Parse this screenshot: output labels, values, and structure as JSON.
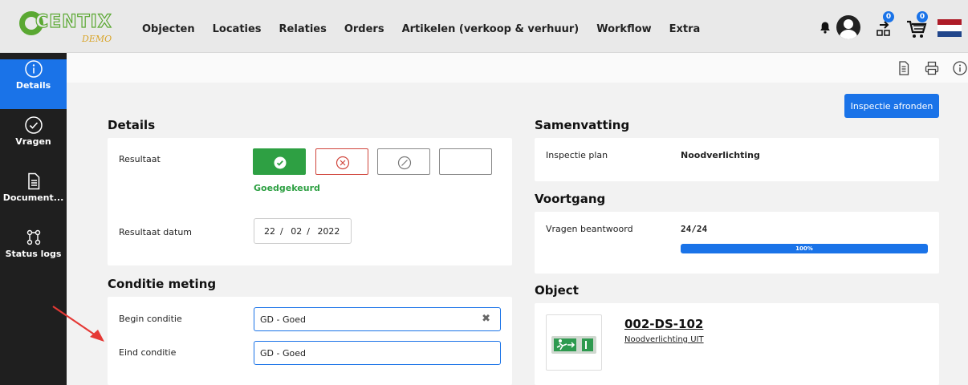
{
  "brand": {
    "logo_text": "CENTIX",
    "logo_sub": "DEMO",
    "green": "#5aa832",
    "gold": "#d9a52a"
  },
  "nav": {
    "items": [
      "Objecten",
      "Locaties",
      "Relaties",
      "Orders",
      "Artikelen (verkoop & verhuur)",
      "Workflow",
      "Extra"
    ]
  },
  "top_icons": {
    "bell": "bell-icon",
    "user": "user-avatar-icon",
    "transfer": "transfer-icon",
    "transfer_badge": "0",
    "cart": "cart-icon",
    "cart_badge": "0",
    "flag": "dutch-flag-icon"
  },
  "sidebar": {
    "items": [
      {
        "label": "Details",
        "icon": "info-icon",
        "active": true
      },
      {
        "label": "Vragen",
        "icon": "check-circle-icon",
        "active": false
      },
      {
        "label": "Document...",
        "icon": "document-icon",
        "active": false
      },
      {
        "label": "Status logs",
        "icon": "status-logs-icon",
        "active": false
      }
    ]
  },
  "toolbar": {
    "icons": [
      "file-icon",
      "print-icon",
      "info-icon"
    ],
    "finish_label": "Inspectie afronden"
  },
  "details": {
    "title": "Details",
    "result_label": "Resultaat",
    "result_options": [
      "approved",
      "rejected",
      "not-applicable",
      "empty"
    ],
    "result_selected": "approved",
    "result_text": "Goedgekeurd",
    "date_label": "Resultaat datum",
    "date": {
      "day": "22",
      "month": "02",
      "year": "2022",
      "sep": "/"
    }
  },
  "condition": {
    "title": "Conditie meting",
    "begin_label": "Begin conditie",
    "begin_value": "GD - Goed",
    "end_label": "Eind conditie",
    "end_value": "GD - Goed"
  },
  "summary": {
    "title": "Samenvatting",
    "plan_label": "Inspectie plan",
    "plan_value": "Noodverlichting"
  },
  "progress": {
    "title": "Voortgang",
    "answered_label": "Vragen beantwoord",
    "answered_value": "24/24",
    "percent": 100,
    "percent_label": "100%"
  },
  "object": {
    "title": "Object",
    "code": "002-DS-102",
    "name": "Noodverlichting UIT"
  },
  "colors": {
    "accent": "#1a73e8",
    "success": "#2ea043",
    "danger": "#d0453c",
    "sidebar": "#1f1f1f",
    "annotation": "#e53935"
  }
}
